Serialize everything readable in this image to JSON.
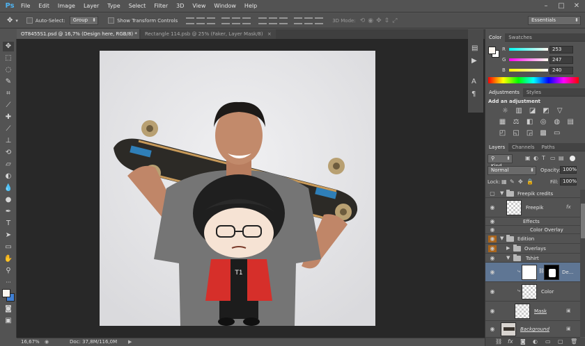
{
  "app": {
    "logo": "Ps"
  },
  "menu": [
    "File",
    "Edit",
    "Image",
    "Layer",
    "Type",
    "Select",
    "Filter",
    "3D",
    "View",
    "Window",
    "Help"
  ],
  "window_controls": [
    "–",
    "□",
    "✕"
  ],
  "options": {
    "auto_select_label": "Auto-Select:",
    "auto_select_value": "Group",
    "show_transform_label": "Show Transform Controls",
    "mode_label": "3D Mode:",
    "workspace": "Essentials"
  },
  "tabs": [
    {
      "label": "OT8455S1.psd @ 16,7% (Design here, RGB/8) *",
      "close": "×",
      "active": true
    },
    {
      "label": "Rectangle 114.psb @ 25% (Faker, Layer Mask/8)",
      "close": "×",
      "active": false
    }
  ],
  "status": {
    "zoom": "16,67%",
    "doc": "Doc: 37,8M/116,0M"
  },
  "color_panel": {
    "tabs": [
      "Color",
      "Swatches"
    ],
    "channels": [
      {
        "label": "R",
        "value": "253",
        "fraction": 0.99
      },
      {
        "label": "G",
        "value": "247",
        "fraction": 0.97
      },
      {
        "label": "B",
        "value": "240",
        "fraction": 0.94
      }
    ],
    "foreground": "#fdf7f0"
  },
  "adjustments": {
    "tabs": [
      "Adjustments",
      "Styles"
    ],
    "heading": "Add an adjustment"
  },
  "layers_panel": {
    "tabs": [
      "Layers",
      "Channels",
      "Paths"
    ],
    "kind_label": "Kind",
    "blend_mode": "Normal",
    "opacity_label": "Opacity:",
    "opacity": "100%",
    "lock_label": "Lock:",
    "fill_label": "Fill:",
    "fill": "100%",
    "layers": [
      {
        "name": "Freepik credits",
        "type": "group-open"
      },
      {
        "name": "Freepik",
        "type": "layer",
        "fx": "fx"
      },
      {
        "name": "Effects",
        "type": "effects"
      },
      {
        "name": "Color Overlay",
        "type": "effect"
      },
      {
        "name": "Edition",
        "type": "group-open"
      },
      {
        "name": "Overlays",
        "type": "group-closed"
      },
      {
        "name": "Tshirt",
        "type": "group-open"
      },
      {
        "name": "De...",
        "type": "smart-selected"
      },
      {
        "name": "Color",
        "type": "layer"
      },
      {
        "name": "Mask",
        "type": "layer"
      },
      {
        "name": "Background",
        "type": "layer"
      }
    ],
    "footer_icons": [
      "link-icon",
      "fx-icon",
      "mask-icon",
      "adjustment-icon",
      "folder-icon",
      "new-layer-icon",
      "trash-icon"
    ]
  },
  "artwork": {
    "badge_text": "T1"
  }
}
